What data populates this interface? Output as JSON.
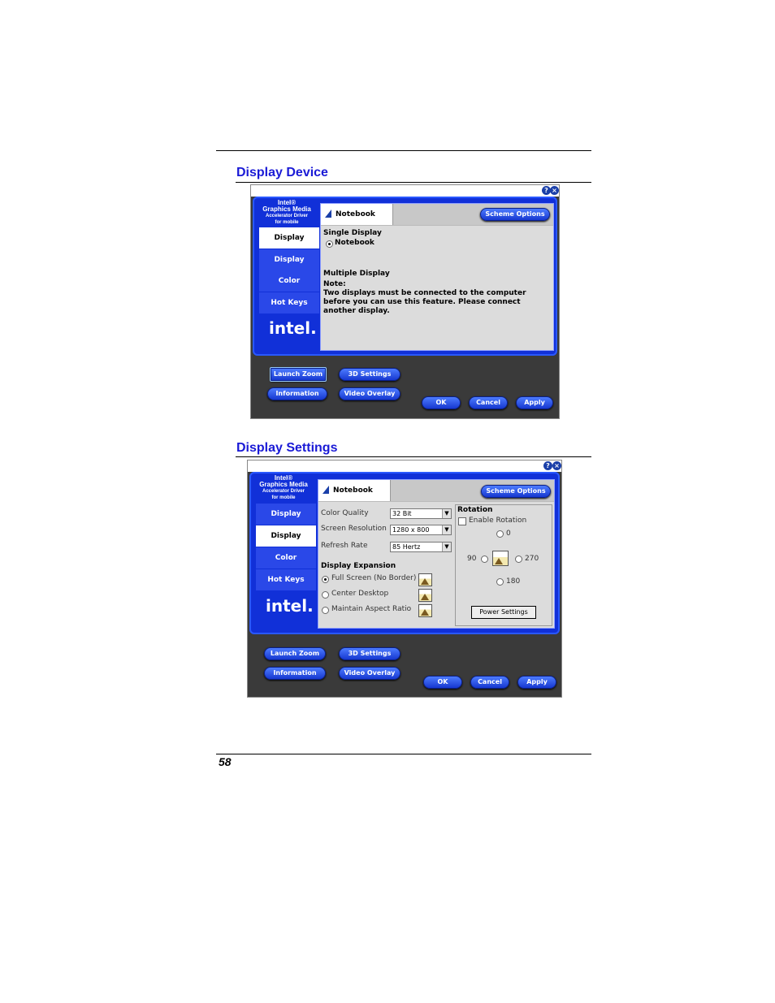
{
  "headings": {
    "device": "Display Device",
    "settings": "Display Settings"
  },
  "page_number": "58",
  "common": {
    "brand_lines": [
      "Intel®",
      "Graphics Media",
      "Accelerator Driver",
      "for mobile"
    ],
    "logo": "intel.",
    "nav": [
      "Display Devices",
      "Display Settings",
      "Color Correction",
      "Hot Keys"
    ],
    "tab": "Notebook",
    "scheme_button": "Scheme Options",
    "buttons": {
      "launch_zoom": "Launch Zoom",
      "settings_3d": "3D Settings",
      "information": "Information",
      "video_overlay": "Video Overlay",
      "ok": "OK",
      "cancel": "Cancel",
      "apply": "Apply"
    },
    "icons": {
      "help": "help-icon",
      "close": "close-icon"
    }
  },
  "device_panel": {
    "single_display": "Single Display",
    "notebook_option": "Notebook",
    "multiple_display": "Multiple Display",
    "note_label": "Note:",
    "note_lines": [
      "Two displays must be connected to the computer",
      "before you can use this feature.  Please connect",
      "another display."
    ]
  },
  "settings_panel": {
    "color_quality_label": "Color Quality",
    "color_quality_value": "32 Bit",
    "screen_resolution_label": "Screen Resolution",
    "screen_resolution_value": "1280 x 800",
    "refresh_rate_label": "Refresh Rate",
    "refresh_rate_value": "85 Hertz",
    "display_expansion": "Display Expansion",
    "expansion_options": [
      "Full Screen (No Border)",
      "Center Desktop",
      "Maintain Aspect Ratio"
    ],
    "rotation": "Rotation",
    "enable_rotation": "Enable Rotation",
    "angles": {
      "a0": "0",
      "a90": "90",
      "a270": "270",
      "a180": "180"
    },
    "power_settings": "Power Settings"
  }
}
